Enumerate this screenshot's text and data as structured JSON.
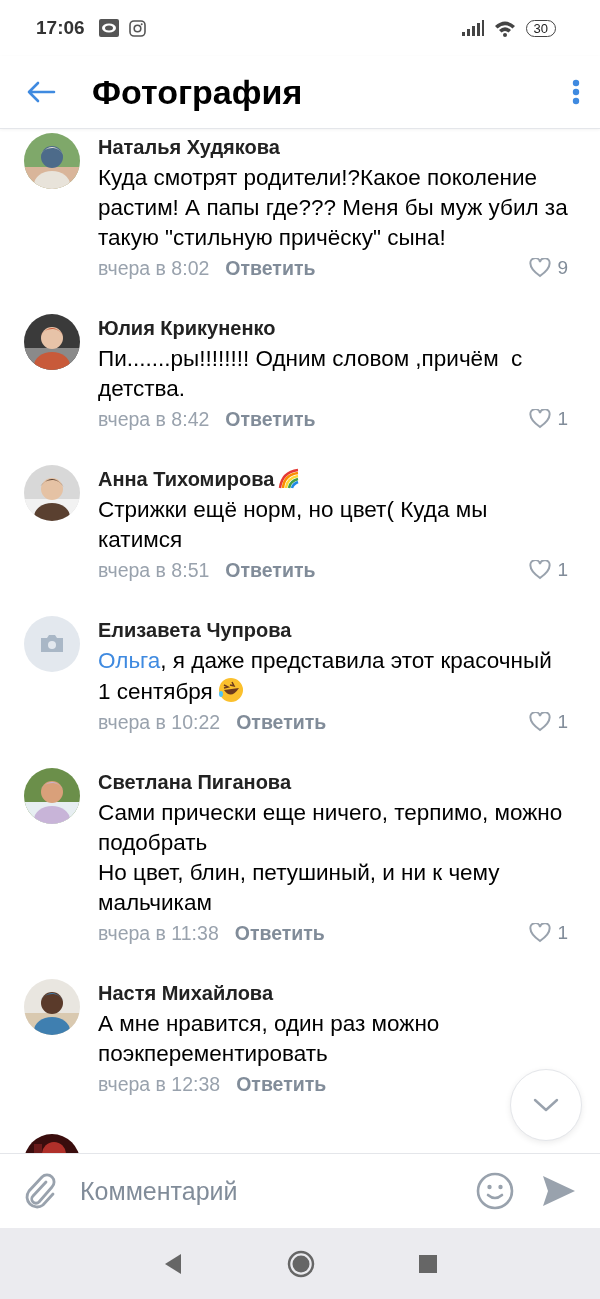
{
  "status_bar": {
    "time": "17:06",
    "battery": "30"
  },
  "header": {
    "title": "Фотография"
  },
  "comments": [
    {
      "author": "Наталья Худякова",
      "text": "Куда смотрят родители!?Какое поколение растим! А папы где??? Меня бы муж убил за такую \"стильную причёску\" сына!",
      "date": "вчера в 8:02",
      "reply": "Ответить",
      "likes": "9"
    },
    {
      "author": "Юлия Крикуненко",
      "text": "Пи.......ры!!!!!!!! Одним словом ,причём  с детства.",
      "date": "вчера в 8:42",
      "reply": "Ответить",
      "likes": "1"
    },
    {
      "author": "Анна Тихомирова",
      "name_icon": {
        "kind": "rainbow"
      },
      "text": "Стрижки ещё норм, но цвет( Куда мы катимся",
      "date": "вчера в 8:51",
      "reply": "Ответить",
      "likes": "1"
    },
    {
      "author": "Елизавета Чупрова",
      "avatar": {
        "kind": "placeholder"
      },
      "mention": "Ольга",
      "text": ", я даже представила этот красочный 1 сентября",
      "text_icon": {
        "kind": "laughing"
      },
      "date": "вчера в 10:22",
      "reply": "Ответить",
      "likes": "1"
    },
    {
      "author": "Светлана Пиганова",
      "text": "Сами прически еще ничего, терпимо, можно подобрать\nНо цвет, блин, петушиный, и ни к чему мальчикам",
      "date": "вчера в 11:38",
      "reply": "Ответить",
      "likes": "1"
    },
    {
      "author": "Настя Михайлова",
      "text": "А мне нравится, один раз можно поэкперементировать",
      "date": "вчера в 12:38",
      "reply": "Ответить"
    }
  ],
  "composer": {
    "placeholder": "Комментарий"
  }
}
